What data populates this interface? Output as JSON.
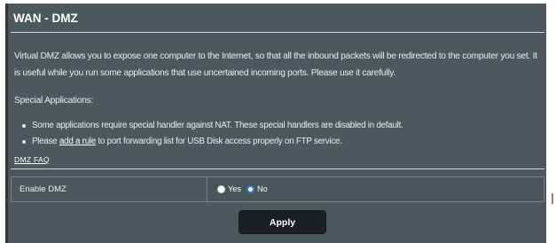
{
  "page": {
    "title": "WAN - DMZ",
    "description": "Virtual DMZ allows you to expose one computer to the Internet, so that all the inbound packets will be redirected to the computer you set. It is useful while you run some applications that use uncertained incoming ports. Please use it carefully.",
    "special_title": "Special Applications:",
    "bullets": {
      "first": "Some applications require special handler against NAT. These special handlers are disabled in default.",
      "second_prefix": "Please ",
      "second_link": "add a rule",
      "second_suffix": " to port forwarding list for USB Disk access properly on FTP service."
    },
    "faq_link": "DMZ  FAQ"
  },
  "settings": {
    "enable_dmz_label": "Enable DMZ",
    "options": [
      "Yes",
      "No"
    ],
    "selected": "No"
  },
  "actions": {
    "apply_label": "Apply"
  },
  "colors": {
    "panel_bg": "#4d585d",
    "divider": "#cfd7da",
    "radio_selected": "#2d7be5",
    "button_bg": "#1c2022"
  },
  "icons": {
    "bullet": "bullet-icon",
    "radio_off": "radio-unchecked-icon",
    "radio_on": "radio-checked-icon"
  }
}
